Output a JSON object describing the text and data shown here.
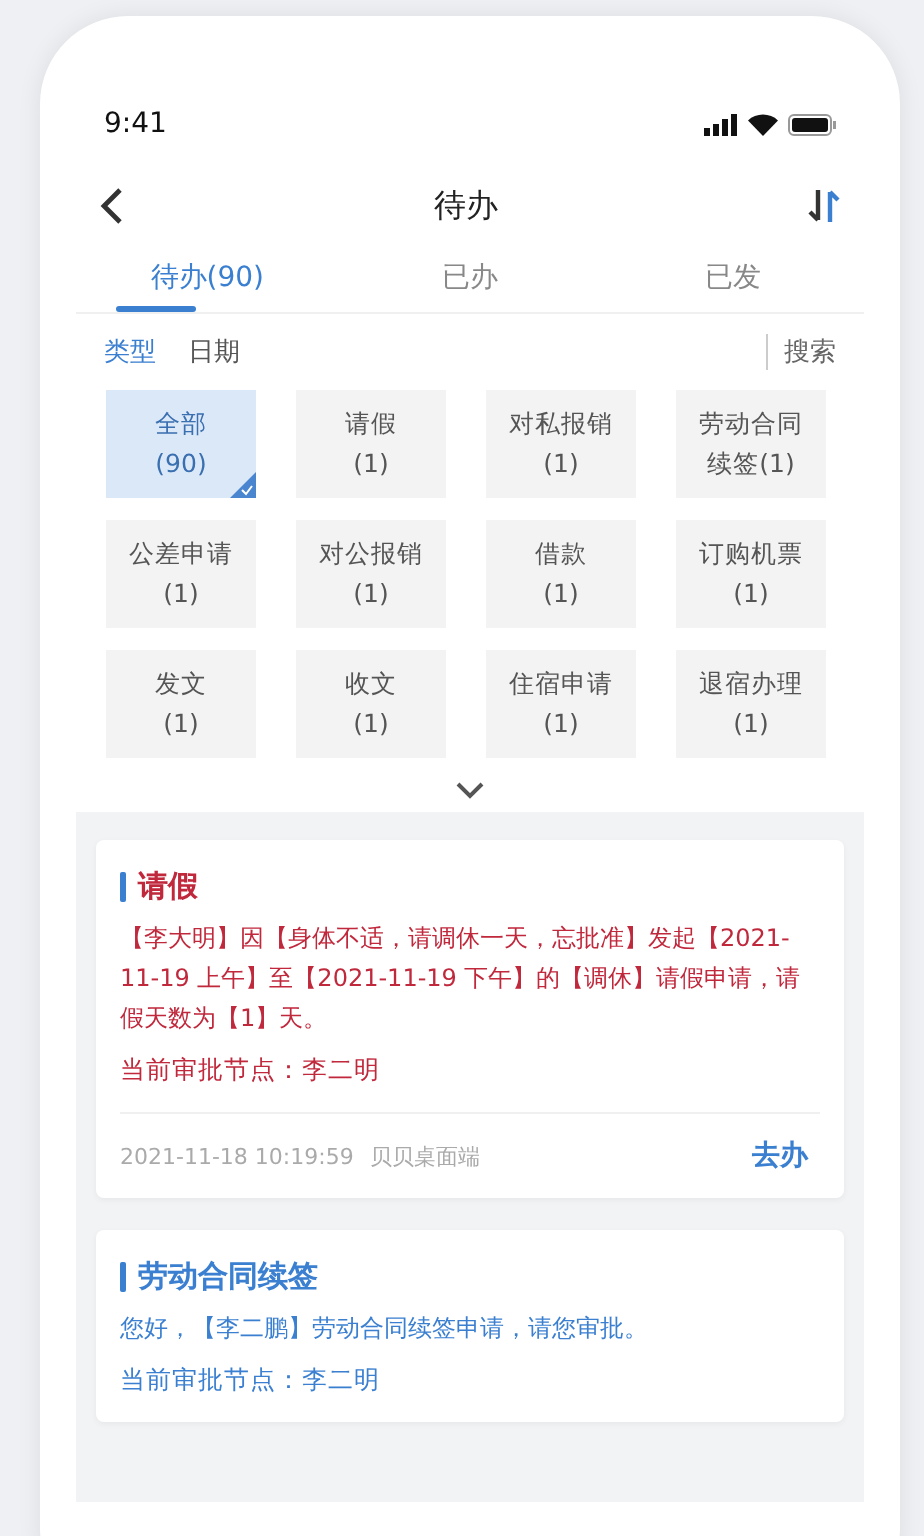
{
  "status_bar": {
    "time": "9:41"
  },
  "header": {
    "title": "待办"
  },
  "tabs": [
    {
      "label": "待办(90)",
      "selected": true
    },
    {
      "label": "已办",
      "selected": false
    },
    {
      "label": "已发",
      "selected": false
    }
  ],
  "filters": [
    {
      "label": "类型",
      "selected": true
    },
    {
      "label": "日期",
      "selected": false
    }
  ],
  "search": {
    "label": "搜索"
  },
  "categories": [
    {
      "name": "全部",
      "count": "(90)",
      "selected": true
    },
    {
      "name": "请假",
      "count": "(1)",
      "selected": false
    },
    {
      "name": "对私报销",
      "count": "(1)",
      "selected": false
    },
    {
      "name": "劳动合同续签(1)",
      "selected": false
    },
    {
      "name": "公差申请",
      "count": "(1)",
      "selected": false
    },
    {
      "name": "对公报销",
      "count": "(1)",
      "selected": false
    },
    {
      "name": "借款",
      "count": "(1)",
      "selected": false
    },
    {
      "name": "订购机票",
      "count": "(1)",
      "selected": false
    },
    {
      "name": "发文",
      "count": "(1)",
      "selected": false
    },
    {
      "name": "收文",
      "count": "(1)",
      "selected": false
    },
    {
      "name": "住宿申请",
      "count": "(1)",
      "selected": false
    },
    {
      "name": "退宿办理",
      "count": "(1)",
      "selected": false
    }
  ],
  "cards": [
    {
      "title": "请假",
      "color": "#c0283c",
      "body": "【李大明】因【身体不适，请调休一天，忘批准】发起【2021-11-19 上午】至【2021-11-19 下午】的【调休】请假申请，请假天数为【1】天。",
      "node": "当前审批节点：李二明",
      "time": "2021-11-18 10:19:59",
      "source": "贝贝桌面端",
      "action": "去办"
    },
    {
      "title": "劳动合同续签",
      "color": "#3a7fd0",
      "body": "您好，【李二鹏】劳动合同续签申请，请您审批。",
      "node": "当前审批节点：李二明"
    }
  ]
}
